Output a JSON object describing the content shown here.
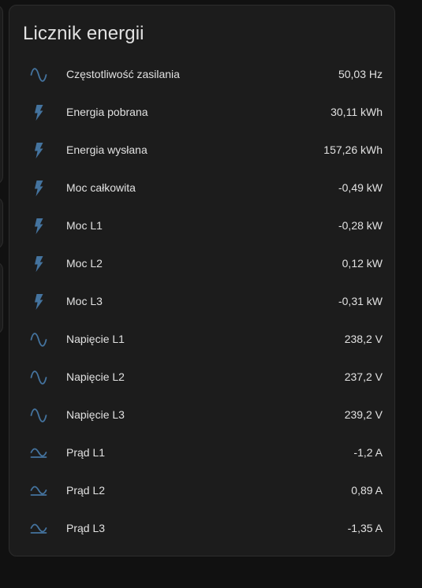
{
  "card": {
    "title": "Licznik energii",
    "accent_color": "#44739e",
    "entities": [
      {
        "icon": "sine-wave-icon",
        "name": "Częstotliwość zasilania",
        "value": "50,03 Hz"
      },
      {
        "icon": "lightning-bolt-icon",
        "name": "Energia pobrana",
        "value": "30,11 kWh"
      },
      {
        "icon": "lightning-bolt-icon",
        "name": "Energia wysłana",
        "value": "157,26 kWh"
      },
      {
        "icon": "lightning-bolt-icon",
        "name": "Moc całkowita",
        "value": "-0,49 kW"
      },
      {
        "icon": "lightning-bolt-icon",
        "name": "Moc L1",
        "value": "-0,28 kW"
      },
      {
        "icon": "lightning-bolt-icon",
        "name": "Moc L2",
        "value": "0,12 kW"
      },
      {
        "icon": "lightning-bolt-icon",
        "name": "Moc L3",
        "value": "-0,31 kW"
      },
      {
        "icon": "sine-wave-icon",
        "name": "Napięcie L1",
        "value": "238,2 V"
      },
      {
        "icon": "sine-wave-icon",
        "name": "Napięcie L2",
        "value": "237,2 V"
      },
      {
        "icon": "sine-wave-icon",
        "name": "Napięcie L3",
        "value": "239,2 V"
      },
      {
        "icon": "current-ac-icon",
        "name": "Prąd L1",
        "value": "-1,2 A"
      },
      {
        "icon": "current-ac-icon",
        "name": "Prąd L2",
        "value": "0,89 A"
      },
      {
        "icon": "current-ac-icon",
        "name": "Prąd L3",
        "value": "-1,35 A"
      }
    ]
  }
}
